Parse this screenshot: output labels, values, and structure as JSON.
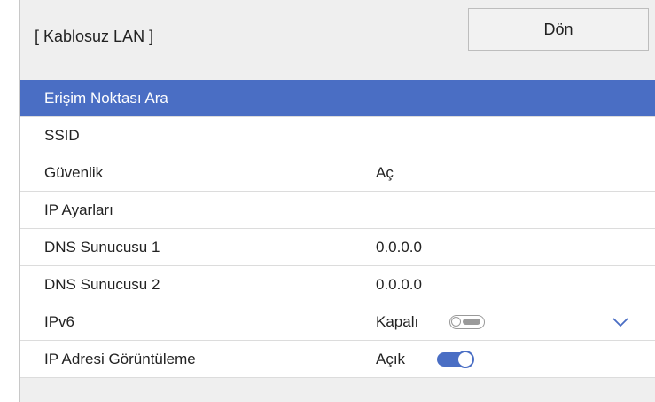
{
  "header": {
    "title": "[ Kablosuz LAN ]",
    "back_label": "Dön"
  },
  "menu": {
    "items": [
      {
        "label": "Erişim Noktası Ara",
        "value": "",
        "selected": true
      },
      {
        "label": "SSID",
        "value": ""
      },
      {
        "label": "Güvenlik",
        "value": "Aç"
      },
      {
        "label": "IP Ayarları",
        "value": ""
      },
      {
        "label": "DNS Sunucusu 1",
        "value": "0.0.0.0"
      },
      {
        "label": "DNS Sunucusu 2",
        "value": "0.0.0.0"
      },
      {
        "label": "IPv6",
        "value": "Kapalı",
        "toggle": "off"
      },
      {
        "label": "IP Adresi Görüntüleme",
        "value": "Açık",
        "toggle": "on"
      }
    ]
  },
  "icons": {
    "scroll_down": "chevron-down-icon"
  },
  "colors": {
    "accent": "#4a6ec4",
    "panel_bg": "#efefef",
    "row_bg": "#ffffff"
  }
}
